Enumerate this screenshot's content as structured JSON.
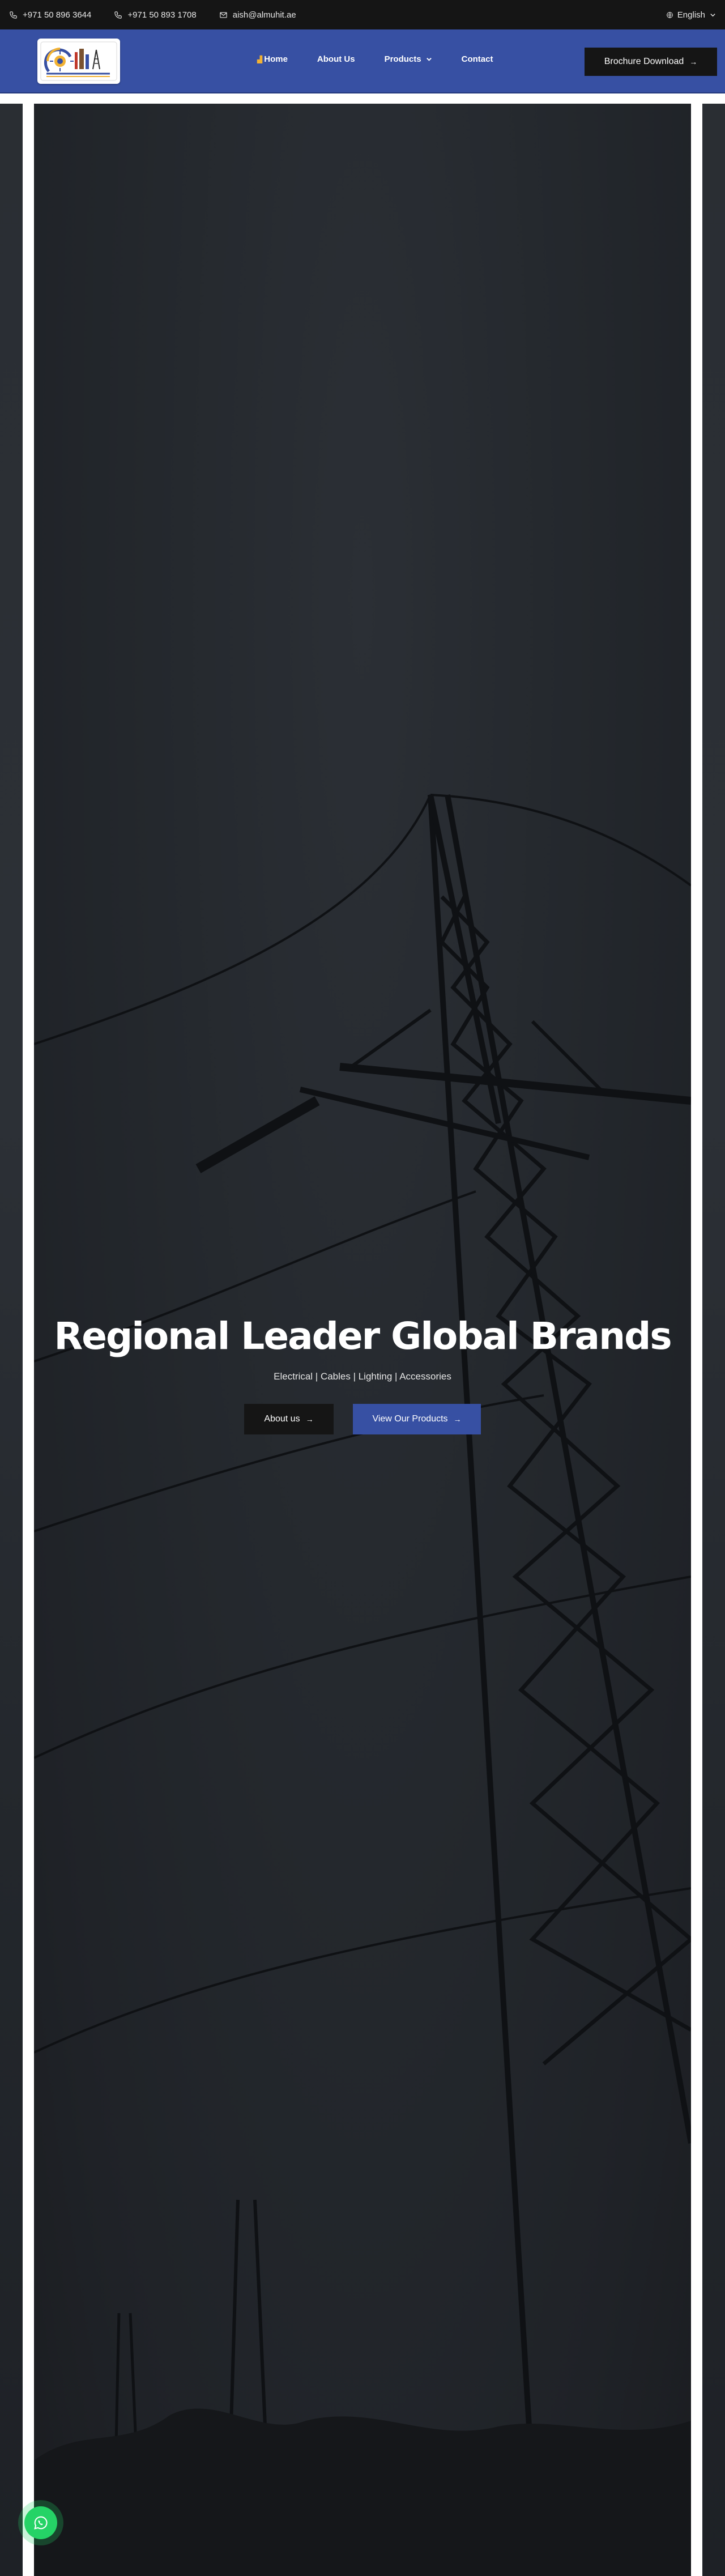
{
  "topbar": {
    "phone1": "+971 50 896 3644",
    "phone2": "+971 50 893 1708",
    "email": "aish@almuhit.ae",
    "language": "English",
    "icons": [
      "phone-icon",
      "phone-icon",
      "mail-icon",
      "globe-icon",
      "chevron-down-icon"
    ]
  },
  "header": {
    "nav": [
      {
        "label": "Home"
      },
      {
        "label": "About Us"
      },
      {
        "label": "Products"
      },
      {
        "label": "Contact"
      }
    ],
    "brochure_label": "Brochure Download",
    "colors": {
      "brand": "#3750a3",
      "dark": "#151515",
      "accent": "#f2b233"
    }
  },
  "hero": {
    "title": "Regional Leader Global Brands",
    "subtitle": "Electrical | Cables | Lighting | Accessories",
    "btn_about": "About us",
    "btn_products": "View Our Products"
  },
  "whatsapp": {
    "icon": "whatsapp-icon",
    "color": "#25d366"
  }
}
